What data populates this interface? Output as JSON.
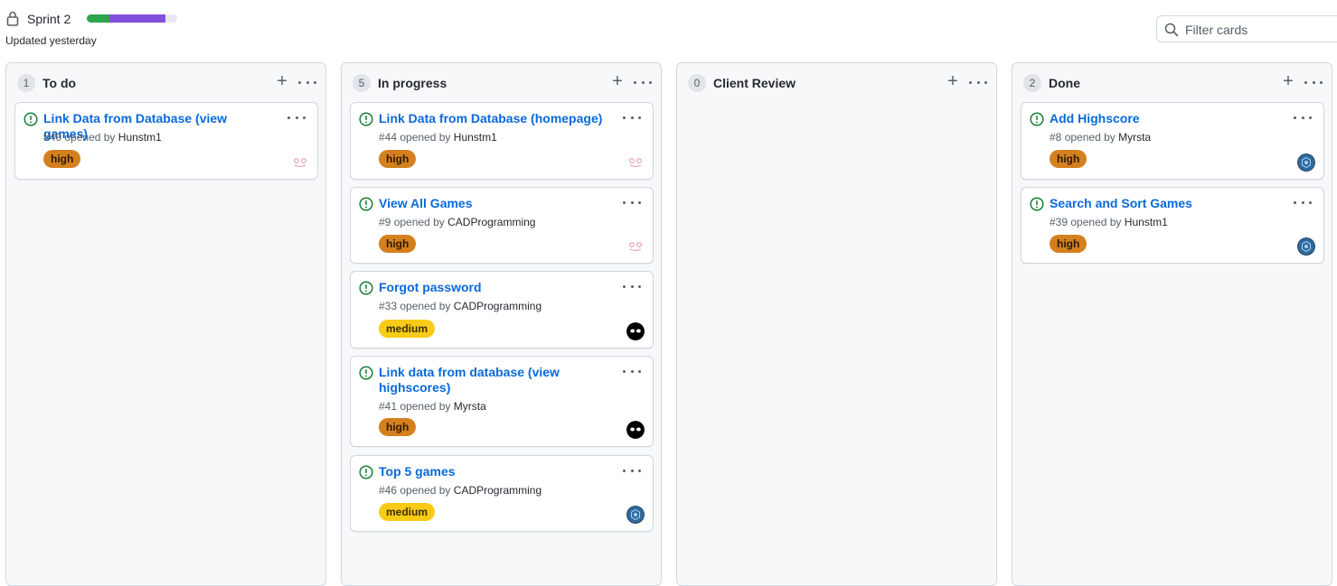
{
  "header": {
    "title": "Sprint 2",
    "updated": "Updated yesterday",
    "progress": {
      "done_percent": 25,
      "in_progress_percent": 62
    },
    "filter_placeholder": "Filter cards"
  },
  "colors": {
    "done": "#2da44e",
    "in_progress": "#8250df",
    "link": "#0969da",
    "issue_open": "#1a7f37",
    "label_high": "#d4801f",
    "label_medium": "#f7cb16"
  },
  "icons": {
    "lock": "lock-icon",
    "search": "search-icon",
    "issue": "issue-opened-icon",
    "plus": "plus-icon",
    "more": "kebab-horizontal-icon"
  },
  "columns": [
    {
      "title": "To do",
      "count": "1",
      "cards": [
        {
          "title": "Link Data from Database (view games)",
          "number": "#40",
          "opened_by": "opened by",
          "author": "Hunstm1",
          "label": "high",
          "avatar": "pink-identicon"
        }
      ]
    },
    {
      "title": "In progress",
      "count": "5",
      "cards": [
        {
          "title": "Link Data from Database (homepage)",
          "number": "#44",
          "opened_by": "opened by",
          "author": "Hunstm1",
          "label": "high",
          "avatar": "pink-identicon"
        },
        {
          "title": "View All Games",
          "number": "#9",
          "opened_by": "opened by",
          "author": "CADProgramming",
          "label": "high",
          "avatar": "pink-identicon"
        },
        {
          "title": "Forgot password",
          "number": "#33",
          "opened_by": "opened by",
          "author": "CADProgramming",
          "label": "medium",
          "avatar": "black-eyes"
        },
        {
          "title": "Link data from database (view highscores)",
          "number": "#41",
          "opened_by": "opened by",
          "author": "Myrsta",
          "label": "high",
          "avatar": "black-eyes"
        },
        {
          "title": "Top 5 games",
          "number": "#46",
          "opened_by": "opened by",
          "author": "CADProgramming",
          "label": "medium",
          "avatar": "blue-badge"
        }
      ]
    },
    {
      "title": "Client Review",
      "count": "0",
      "cards": []
    },
    {
      "title": "Done",
      "count": "2",
      "cards": [
        {
          "title": "Add Highscore",
          "number": "#8",
          "opened_by": "opened by",
          "author": "Myrsta",
          "label": "high",
          "avatar": "blue-badge"
        },
        {
          "title": "Search and Sort Games",
          "number": "#39",
          "opened_by": "opened by",
          "author": "Hunstm1",
          "label": "high",
          "avatar": "blue-badge"
        }
      ]
    }
  ]
}
